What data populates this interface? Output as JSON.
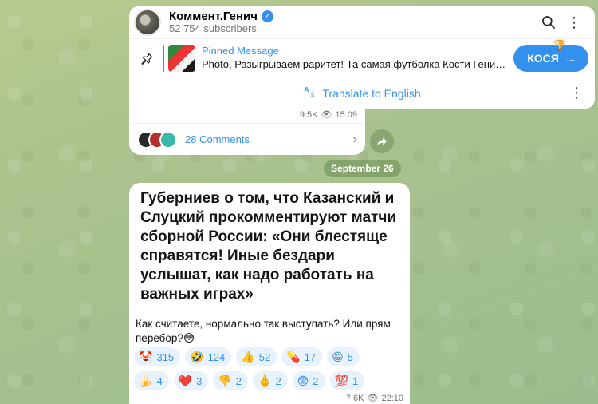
{
  "header": {
    "channel_title": "Коммент.Генич",
    "subscribers": "52 754 subscribers"
  },
  "pinned": {
    "label": "Pinned Message",
    "body": "Photo, Разыгрываем раритет! Та самая футболка Кости Генича, в ко...",
    "button_label": "КОСЯ",
    "button_dots": "..."
  },
  "translate": {
    "label": "Translate to English"
  },
  "previous_post": {
    "views": "9.5K",
    "time": "15:09",
    "comments_label": "28 Comments"
  },
  "date_separator": "September 26",
  "post": {
    "headline": "Губерниев о том, что Казанский и Слуцкий прокомментируют матчи сборной России: «Они блестяще справятся! Иные бездари услышат, как надо работать на важных играх»",
    "text": "Как считаете, нормально так выступать? Или прям перебор?😳",
    "reactions_row1": [
      {
        "emoji": "🤡",
        "count": "315"
      },
      {
        "emoji": "🤣",
        "count": "124"
      },
      {
        "emoji": "👍",
        "count": "52"
      },
      {
        "emoji": "💊",
        "count": "17"
      },
      {
        "emoji": "😁",
        "count": "5"
      }
    ],
    "reactions_row2": [
      {
        "emoji": "🍌",
        "count": "4"
      },
      {
        "emoji": "❤️",
        "count": "3"
      },
      {
        "emoji": "👎",
        "count": "2"
      },
      {
        "emoji": "🖕",
        "count": "2"
      },
      {
        "emoji": "😨",
        "count": "2"
      },
      {
        "emoji": "💯",
        "count": "1"
      }
    ],
    "views": "7.6K",
    "time": "22:10"
  },
  "colors": {
    "accent": "#3390ec",
    "secondary_text": "#707579"
  }
}
